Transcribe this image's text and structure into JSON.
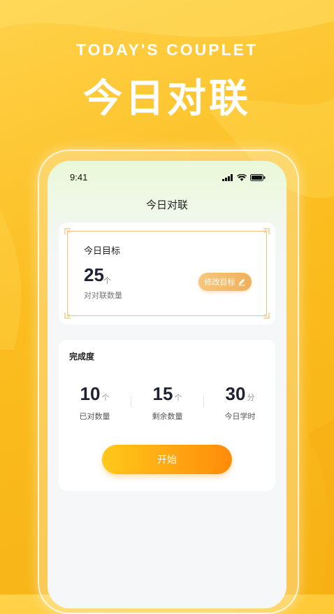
{
  "promo": {
    "subtitle": "TODAY'S COUPLET",
    "title": "今日对联"
  },
  "status_bar": {
    "time": "9:41",
    "icons": [
      "signal-icon",
      "wifi-icon",
      "battery-icon"
    ]
  },
  "nav": {
    "title": "今日对联"
  },
  "goal": {
    "label": "今日目标",
    "value": "25",
    "unit": "个",
    "description": "对对联数量",
    "edit_button": "修改目标",
    "edit_icon": "pencil-icon"
  },
  "progress": {
    "title": "完成度",
    "stats": [
      {
        "value": "10",
        "unit": "个",
        "label": "已对数量"
      },
      {
        "value": "15",
        "unit": "个",
        "label": "剩余数量"
      },
      {
        "value": "30",
        "unit": "分",
        "label": "今日学时"
      }
    ],
    "start_button": "开始"
  },
  "colors": {
    "background": "#fbbd1f",
    "accent_gradient_start": "#ffc81a",
    "accent_gradient_end": "#ff8c0a",
    "goal_border": "#f0c27a"
  }
}
